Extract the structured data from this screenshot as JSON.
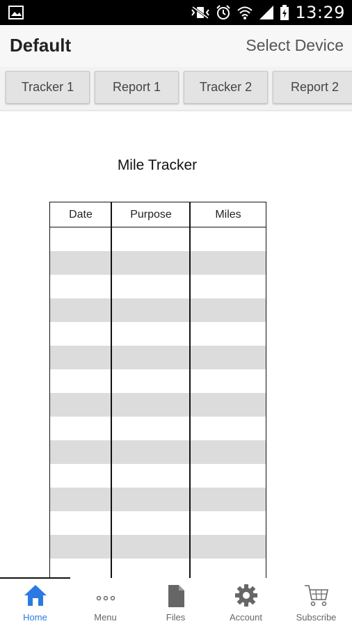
{
  "status_bar": {
    "time": "13:29"
  },
  "header": {
    "title": "Default",
    "select_device": "Select Device"
  },
  "tabs": [
    {
      "label": "Tracker 1"
    },
    {
      "label": "Report 1"
    },
    {
      "label": "Tracker 2"
    },
    {
      "label": "Report 2"
    }
  ],
  "document": {
    "title": "Mile Tracker",
    "columns": [
      "Date",
      "Purpose",
      "Miles"
    ],
    "row_shading": [
      "white",
      "gray",
      "white",
      "gray",
      "white",
      "gray",
      "white",
      "gray",
      "white",
      "gray",
      "white",
      "gray",
      "white",
      "gray",
      "white"
    ]
  },
  "bottom_nav": [
    {
      "label": "Home",
      "icon": "home-icon",
      "active": true
    },
    {
      "label": "Menu",
      "icon": "dots-icon",
      "active": false
    },
    {
      "label": "Files",
      "icon": "file-icon",
      "active": false
    },
    {
      "label": "Account",
      "icon": "gear-icon",
      "active": false
    },
    {
      "label": "Subscribe",
      "icon": "cart-icon",
      "active": false
    }
  ],
  "colors": {
    "active": "#2a7ae2",
    "inactive_icon": "#666666",
    "row_shade": "#dcdcdc"
  }
}
